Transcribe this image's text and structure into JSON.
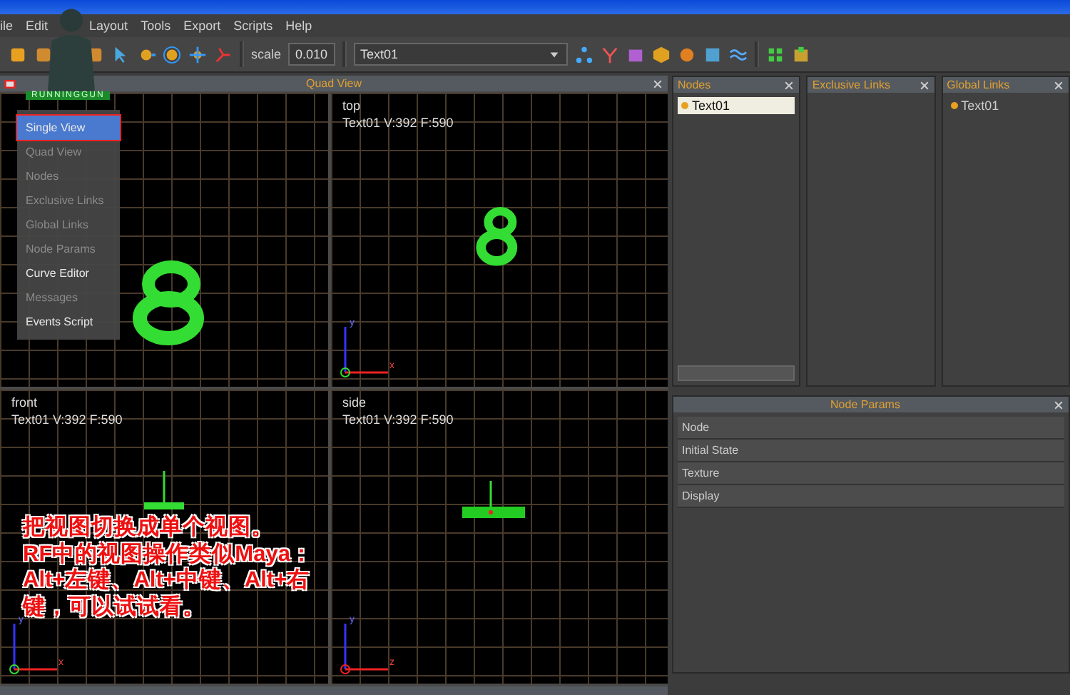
{
  "menu_bar": [
    {
      "label": "ile"
    },
    {
      "label": "Edit"
    },
    {
      "label": "Layout"
    },
    {
      "label": "Tools"
    },
    {
      "label": "Export"
    },
    {
      "label": "Scripts"
    },
    {
      "label": "Help"
    }
  ],
  "toolbar": {
    "scale_label": "scale",
    "scale_value": "0.010",
    "object_select": "Text01"
  },
  "overlay_logo": "RUNNINGGUN",
  "quad_view": {
    "title": "Quad View",
    "view_menu": [
      {
        "label": "Single View",
        "selected": true,
        "disabled": false
      },
      {
        "label": "Quad View",
        "selected": false,
        "disabled": true
      },
      {
        "label": "Nodes",
        "selected": false,
        "disabled": true
      },
      {
        "label": "Exclusive Links",
        "selected": false,
        "disabled": true
      },
      {
        "label": "Global Links",
        "selected": false,
        "disabled": true
      },
      {
        "label": "Node Params",
        "selected": false,
        "disabled": true
      },
      {
        "label": "Curve Editor",
        "selected": false,
        "disabled": false
      },
      {
        "label": "Messages",
        "selected": false,
        "disabled": true
      },
      {
        "label": "Events Script",
        "selected": false,
        "disabled": false
      }
    ],
    "viewports": [
      {
        "kind": "perspective"
      },
      {
        "kind": "top",
        "label": "top",
        "info": "Text01 V:392 F:590",
        "axes": [
          "y",
          "x"
        ]
      },
      {
        "kind": "front",
        "label": "front",
        "info": "Text01 V:392 F:590",
        "axes": [
          "y",
          "x"
        ]
      },
      {
        "kind": "side",
        "label": "side",
        "info": "Text01 V:392 F:590",
        "axes": [
          "y",
          "z"
        ]
      }
    ]
  },
  "panels": [
    {
      "title": "Nodes",
      "items": [
        {
          "label": "Text01",
          "selected": true
        }
      ]
    },
    {
      "title": "Exclusive Links"
    },
    {
      "title": "Global Links",
      "items": [
        {
          "label": "Text01",
          "selected": false
        }
      ]
    }
  ],
  "node_params": {
    "title": "Node Params",
    "sections": [
      "Node",
      "Initial State",
      "Texture",
      "Display"
    ]
  },
  "caption": [
    "把视图切换成单个视图。",
    "RF中的视图操作类似Maya：",
    "Alt+左键、Alt+中键、Alt+右",
    "键，可以试试看。"
  ]
}
